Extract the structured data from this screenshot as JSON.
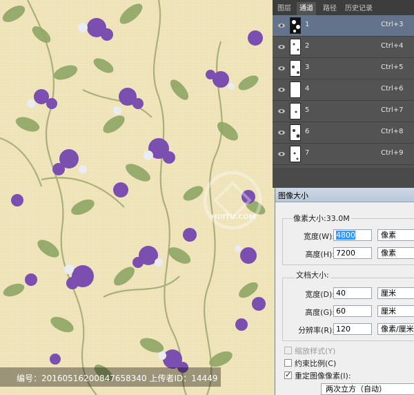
{
  "panel": {
    "tabs": [
      "图层",
      "通道",
      "路径",
      "历史记录"
    ],
    "active_tab": "通道",
    "channels": [
      {
        "name": "1",
        "shortcut": "Ctrl+3",
        "selected": true
      },
      {
        "name": "2",
        "shortcut": "Ctrl+4",
        "selected": false
      },
      {
        "name": "3",
        "shortcut": "Ctrl+5",
        "selected": false
      },
      {
        "name": "4",
        "shortcut": "Ctrl+6",
        "selected": false
      },
      {
        "name": "5",
        "shortcut": "Ctrl+7",
        "selected": false
      },
      {
        "name": "6",
        "shortcut": "Ctrl+8",
        "selected": false
      },
      {
        "name": "7",
        "shortcut": "Ctrl+9",
        "selected": false
      }
    ]
  },
  "dialog": {
    "title": "图像大小",
    "pixel_dimensions_label": "像素大小:33.0M",
    "width_label": "宽度(W):",
    "width_value": "4800",
    "width_unit": "像素",
    "height_label": "高度(H):",
    "height_value": "7200",
    "height_unit": "像素",
    "document_size_label": "文档大小:",
    "doc_width_label": "宽度(D):",
    "doc_width_value": "40",
    "doc_width_unit": "厘米",
    "doc_height_label": "高度(G):",
    "doc_height_value": "60",
    "doc_height_unit": "厘米",
    "resolution_label": "分辨率(R):",
    "resolution_value": "120",
    "resolution_unit": "像素/厘米",
    "scale_styles_label": "缩放样式(Y)",
    "constrain_label": "约束比例(C)",
    "resample_label": "重定图像像素(I):",
    "resample_method": "两次立方（自动）"
  },
  "watermark": {
    "text": "编号：20160516200847658340 上传者ID：14449",
    "logo_text": "HUITU.COM"
  },
  "colors": {
    "background": "#f1e6bd",
    "panel": "#535353",
    "selected_row": "#64738c",
    "flower_purple": "#7a4fb0",
    "leaf_green": "#7f9a5c"
  }
}
